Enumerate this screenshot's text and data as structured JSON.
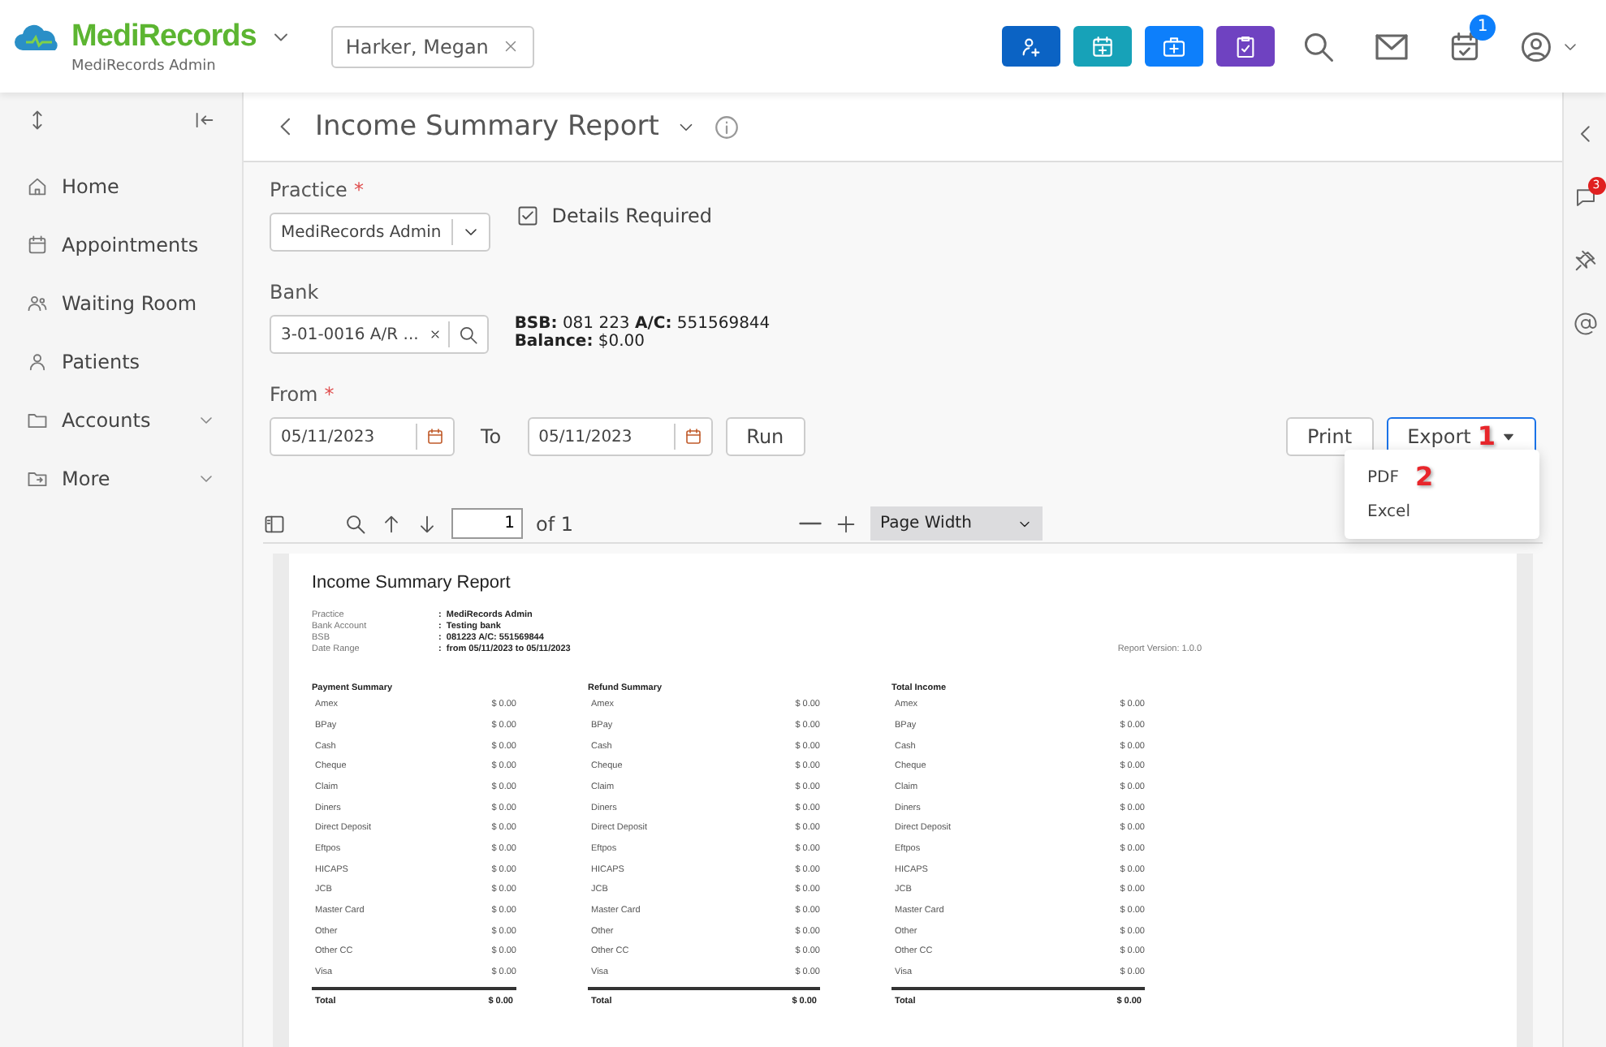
{
  "header": {
    "brand": "MediRecords",
    "brand_subtitle": "MediRecords Admin",
    "patient_tab": {
      "label": "Harker, Megan"
    },
    "quick_actions": [
      {
        "kind": "add-patient",
        "color": "#0b63c4"
      },
      {
        "kind": "calendar",
        "color": "#17a2b8"
      },
      {
        "kind": "medkit",
        "color": "#0d7ffb"
      },
      {
        "kind": "clipboard",
        "color": "#6f42c1"
      }
    ],
    "tasks_badge": "1"
  },
  "sidebar": {
    "items": [
      {
        "kind": "home",
        "label": "Home",
        "expandable": false
      },
      {
        "kind": "calendar",
        "label": "Appointments",
        "expandable": false
      },
      {
        "kind": "people",
        "label": "Waiting Room",
        "expandable": false
      },
      {
        "kind": "person",
        "label": "Patients",
        "expandable": false
      },
      {
        "kind": "folder",
        "label": "Accounts",
        "expandable": true
      },
      {
        "kind": "folder-share",
        "label": "More",
        "expandable": true
      }
    ]
  },
  "right_rail": {
    "comments_badge": "3"
  },
  "page": {
    "title": "Income Summary Report",
    "practice": {
      "label": "Practice",
      "required_mark": "*",
      "value": "MediRecords Admin"
    },
    "details_required": {
      "label": "Details Required",
      "checked": true
    },
    "bank": {
      "label": "Bank",
      "value": "3-01-0016 A/R ...",
      "info_line_1": "**BSB:** 081 223 **A/C:** 551569844",
      "info_line_2": "**Balance:** $0.00"
    },
    "from": {
      "label": "From",
      "required_mark": "*",
      "value": "05/11/2023"
    },
    "to": {
      "label": "To",
      "value": "05/11/2023"
    },
    "run_button": "Run",
    "print_button": "Print",
    "export_button": "Export",
    "export_menu": {
      "open": true,
      "items": [
        {
          "label": "PDF",
          "step_marker": "2"
        },
        {
          "label": "Excel"
        }
      ]
    },
    "export_step_marker": "1"
  },
  "viewer": {
    "page_number": "1",
    "page_count": "of 1",
    "zoom": "Page Width"
  },
  "report": {
    "title": "Income Summary Report",
    "meta": [
      {
        "label": "Practice",
        "value": ":  MediRecords Admin"
      },
      {
        "label": "Bank Account",
        "value": ":  Testing bank"
      },
      {
        "label": "BSB",
        "value": ":  081223 A/C: 551569844"
      },
      {
        "label": "Date Range",
        "value": ":  from 05/11/2023 to 05/11/2023"
      }
    ],
    "version": "Report Version: 1.0.0",
    "sections": [
      {
        "title": "Payment Summary",
        "rows": [
          {
            "label": "Amex",
            "amount": "$ 0.00"
          },
          {
            "label": "BPay",
            "amount": "$ 0.00"
          },
          {
            "label": "Cash",
            "amount": "$ 0.00"
          },
          {
            "label": "Cheque",
            "amount": "$ 0.00"
          },
          {
            "label": "Claim",
            "amount": "$ 0.00"
          },
          {
            "label": "Diners",
            "amount": "$ 0.00"
          },
          {
            "label": "Direct Deposit",
            "amount": "$ 0.00"
          },
          {
            "label": "Eftpos",
            "amount": "$ 0.00"
          },
          {
            "label": "HICAPS",
            "amount": "$ 0.00"
          },
          {
            "label": "JCB",
            "amount": "$ 0.00"
          },
          {
            "label": "Master Card",
            "amount": "$ 0.00"
          },
          {
            "label": "Other",
            "amount": "$ 0.00"
          },
          {
            "label": "Other CC",
            "amount": "$ 0.00"
          },
          {
            "label": "Visa",
            "amount": "$ 0.00"
          }
        ],
        "total_label": "Total",
        "total": "$ 0.00"
      },
      {
        "title": "Refund Summary",
        "rows": [
          {
            "label": "Amex",
            "amount": "$ 0.00"
          },
          {
            "label": "BPay",
            "amount": "$ 0.00"
          },
          {
            "label": "Cash",
            "amount": "$ 0.00"
          },
          {
            "label": "Cheque",
            "amount": "$ 0.00"
          },
          {
            "label": "Claim",
            "amount": "$ 0.00"
          },
          {
            "label": "Diners",
            "amount": "$ 0.00"
          },
          {
            "label": "Direct Deposit",
            "amount": "$ 0.00"
          },
          {
            "label": "Eftpos",
            "amount": "$ 0.00"
          },
          {
            "label": "HICAPS",
            "amount": "$ 0.00"
          },
          {
            "label": "JCB",
            "amount": "$ 0.00"
          },
          {
            "label": "Master Card",
            "amount": "$ 0.00"
          },
          {
            "label": "Other",
            "amount": "$ 0.00"
          },
          {
            "label": "Other CC",
            "amount": "$ 0.00"
          },
          {
            "label": "Visa",
            "amount": "$ 0.00"
          }
        ],
        "total_label": "Total",
        "total": "$ 0.00"
      },
      {
        "title": "Total Income",
        "rows": [
          {
            "label": "Amex",
            "amount": "$ 0.00"
          },
          {
            "label": "BPay",
            "amount": "$ 0.00"
          },
          {
            "label": "Cash",
            "amount": "$ 0.00"
          },
          {
            "label": "Cheque",
            "amount": "$ 0.00"
          },
          {
            "label": "Claim",
            "amount": "$ 0.00"
          },
          {
            "label": "Diners",
            "amount": "$ 0.00"
          },
          {
            "label": "Direct Deposit",
            "amount": "$ 0.00"
          },
          {
            "label": "Eftpos",
            "amount": "$ 0.00"
          },
          {
            "label": "HICAPS",
            "amount": "$ 0.00"
          },
          {
            "label": "JCB",
            "amount": "$ 0.00"
          },
          {
            "label": "Master Card",
            "amount": "$ 0.00"
          },
          {
            "label": "Other",
            "amount": "$ 0.00"
          },
          {
            "label": "Other CC",
            "amount": "$ 0.00"
          },
          {
            "label": "Visa",
            "amount": "$ 0.00"
          }
        ],
        "total_label": "Total",
        "total": "$ 0.00"
      }
    ]
  }
}
